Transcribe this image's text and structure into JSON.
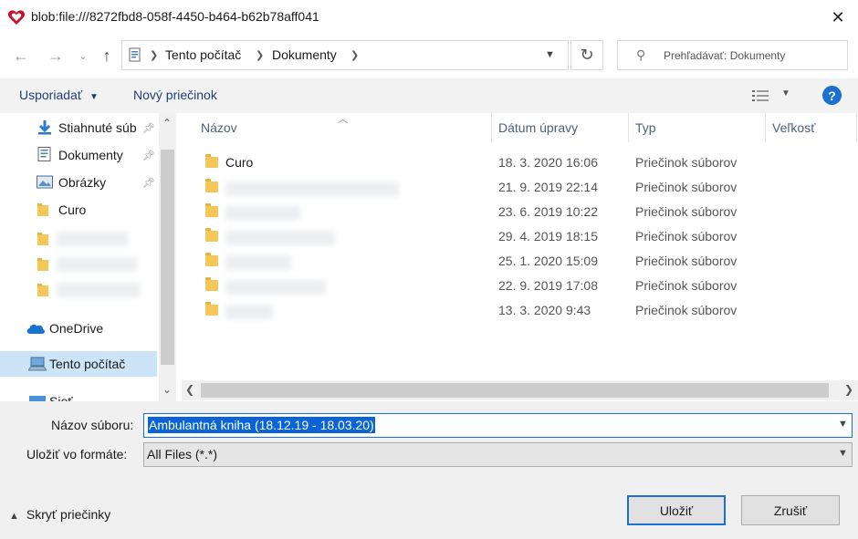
{
  "window": {
    "title": "blob:file:///8272fbd8-058f-4450-b464-b62b78aff041",
    "close_icon": "close-icon",
    "app_icon": "heart-icon",
    "app_icon_color": "#c8102e"
  },
  "address": {
    "crumbs": [
      "Tento počítač",
      "Dokumenty"
    ],
    "search_placeholder": "Prehľadávať: Dokumenty"
  },
  "toolbar": {
    "organize_label": "Usporiadať",
    "new_folder_label": "Nový priečinok",
    "help_label": "?"
  },
  "sidebar": {
    "items": [
      {
        "label": "Stiahnuté súb",
        "icon": "download-arrow-icon",
        "pinned": true
      },
      {
        "label": "Dokumenty",
        "icon": "document-icon",
        "pinned": true
      },
      {
        "label": "Obrázky",
        "icon": "pictures-icon",
        "pinned": true
      },
      {
        "label": "Curo",
        "icon": "folder-icon",
        "pinned": false
      },
      {
        "label": "OneDrive",
        "icon": "cloud-icon",
        "pinned": false
      },
      {
        "label": "Tento počítač",
        "icon": "computer-icon",
        "pinned": false,
        "selected": true
      },
      {
        "label": "Sieť",
        "icon": "network-icon",
        "pinned": false
      }
    ]
  },
  "file_list": {
    "columns": [
      "Názov",
      "Dátum úpravy",
      "Typ",
      "Veľkosť"
    ],
    "rows": [
      {
        "name": "Curo",
        "date": "18. 3. 2020 16:06",
        "type": "Priečinok súborov"
      },
      {
        "name": "",
        "date": "21. 9. 2019 22:14",
        "type": "Priečinok súborov"
      },
      {
        "name": "",
        "date": "23. 6. 2019 10:22",
        "type": "Priečinok súborov"
      },
      {
        "name": "",
        "date": "29. 4. 2019 18:15",
        "type": "Priečinok súborov"
      },
      {
        "name": "",
        "date": "25. 1. 2020 15:09",
        "type": "Priečinok súborov"
      },
      {
        "name": "",
        "date": "22. 9. 2019 17:08",
        "type": "Priečinok súborov"
      },
      {
        "name": "",
        "date": "13. 3. 2020 9:43",
        "type": "Priečinok súborov"
      }
    ]
  },
  "save_form": {
    "filename_label": "Názov súboru:",
    "filename_value": "Ambulantná kniha (18.12.19 - 18.03.20)",
    "format_label": "Uložiť vo formáte:",
    "format_value": "All Files (*.*)",
    "hide_folders_label": "Skryť priečinky",
    "save_label": "Uložiť",
    "cancel_label": "Zrušiť"
  }
}
